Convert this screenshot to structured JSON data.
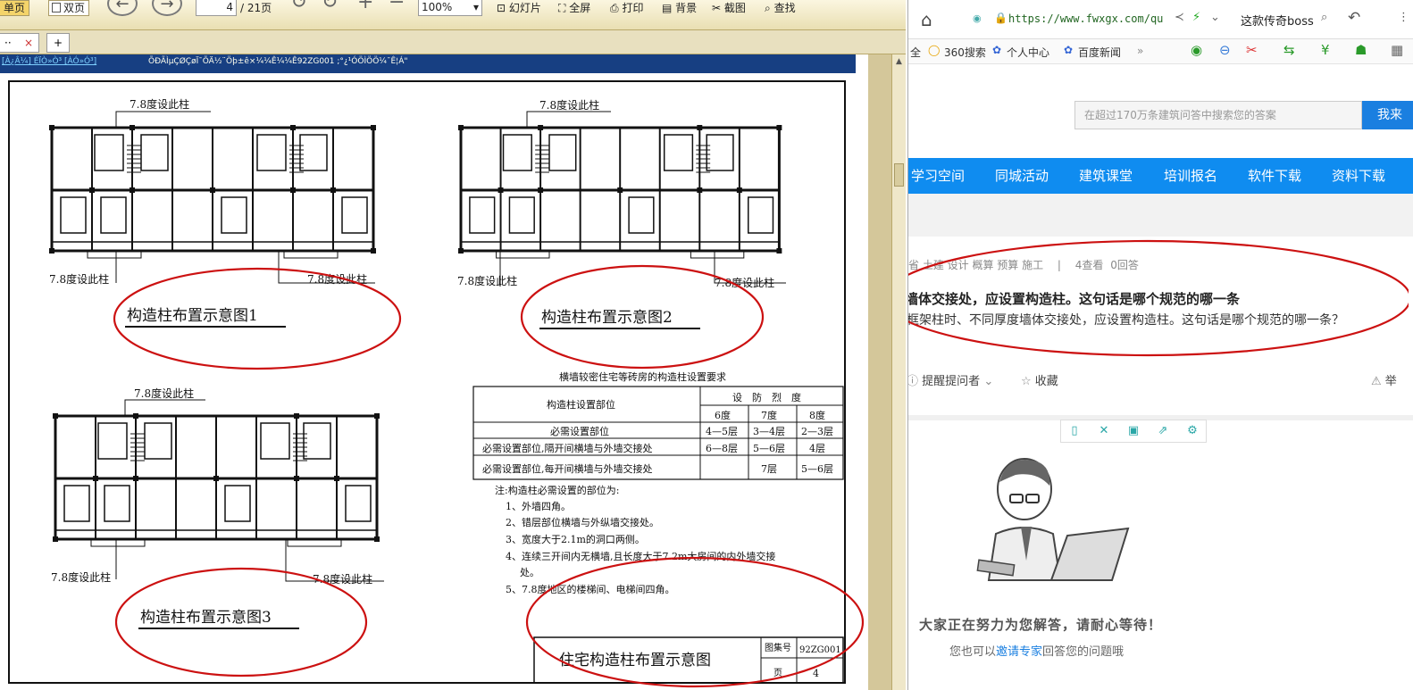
{
  "reader": {
    "toolbar": {
      "single_page": "单页",
      "double_page": "双页",
      "page_current": "4",
      "page_total": "/ 21页",
      "zoom": "100%",
      "slideshow": "幻灯片",
      "fullscreen": "全屏",
      "print": "打印",
      "background": "背景",
      "screenshot": "截图",
      "find": "查找"
    },
    "tabs": {
      "doc_tab": "·· ",
      "add_tab": "+"
    },
    "page_header": {
      "left": "[À¿Â¼] ÉÏÒ»Ò³ [ÀÓ»Ó³]",
      "right": "ÕÐÃÌµÇØÇøÏ¯ÕÄ½¨Öþ±ê×¼¼Ê¼¼Ê92ZG001 ;°¿¹ÓÖÌÖÖ¼¯Ê¦Á\""
    },
    "figure": {
      "col_label": "7.8度设此柱",
      "diagram1_title": "构造柱布置示意图1",
      "diagram2_title": "构造柱布置示意图2",
      "diagram3_title": "构造柱布置示意图3",
      "table_title": "横墙较密住宅等砖房的构造柱设置要求",
      "table_head_pos": "构造柱设置部位",
      "table_head_int": "设　防　烈　度",
      "deg6": "6度",
      "deg7": "7度",
      "deg8": "8度",
      "rows": [
        {
          "pos": "必需设置部位",
          "d6": "4—5层",
          "d7": "3—4层",
          "d8": "2—3层"
        },
        {
          "pos": "必需设置部位,隔开间横墙与外墙交接处",
          "d6": "6—8层",
          "d7": "5—6层",
          "d8": "4层"
        },
        {
          "pos": "必需设置部位,每开间横墙与外墙交接处",
          "d6": "",
          "d7": "7层",
          "d8": "5—6层"
        }
      ],
      "notes": [
        "注:构造柱必需设置的部位为:",
        "1、外墙四角。",
        "2、错层部位横墙与外纵墙交接处。",
        "3、宽度大于2.1m的洞口两侧。",
        "4、连续三开间内无横墙,且长度大于7.2m大房间的内外墙交接",
        "处。",
        "5、7.8度地区的楼梯间、电梯间四角。"
      ],
      "title_block": "住宅构造柱布置示意图",
      "atlas_label": "图集号",
      "atlas_no": "92ZG001",
      "page_label": "页",
      "page_no": "4"
    }
  },
  "browser": {
    "url": "https://www.fwxgx.com/qu",
    "search_hint": "这款传奇boss",
    "bookmarks": [
      "全",
      "360搜索",
      "个人中心",
      "百度新闻",
      "»"
    ],
    "site_search_placeholder": "在超过170万条建筑问答中搜索您的答案",
    "site_search_button": "我来",
    "nav": [
      "学习空间",
      "同城活动",
      "建筑课堂",
      "培训报名",
      "软件下载",
      "资料下载"
    ],
    "question": {
      "tags": "省  土建 设计 概算 预算 施工",
      "sep": "|",
      "views": "4查看",
      "answers": "0回答",
      "title": "墙体交接处，应设置构造柱。这句话是哪个规范的哪一条",
      "desc": "框架柱时、不同厚度墙体交接处，应设置构造柱。这句话是哪个规范的哪一条？",
      "remind": "提醒提问者",
      "favorite": "收藏",
      "report": "举"
    },
    "waiting": {
      "line1": "大家正在努力为您解答，请耐心等待！",
      "line2_pre": "您也可以",
      "line2_link": "邀请专家",
      "line2_post": "回答您的问题哦"
    }
  },
  "colors": {
    "annotation_red": "#cc1111",
    "nav_blue": "#0f8cf0",
    "reader_bg": "#d4c79a"
  }
}
